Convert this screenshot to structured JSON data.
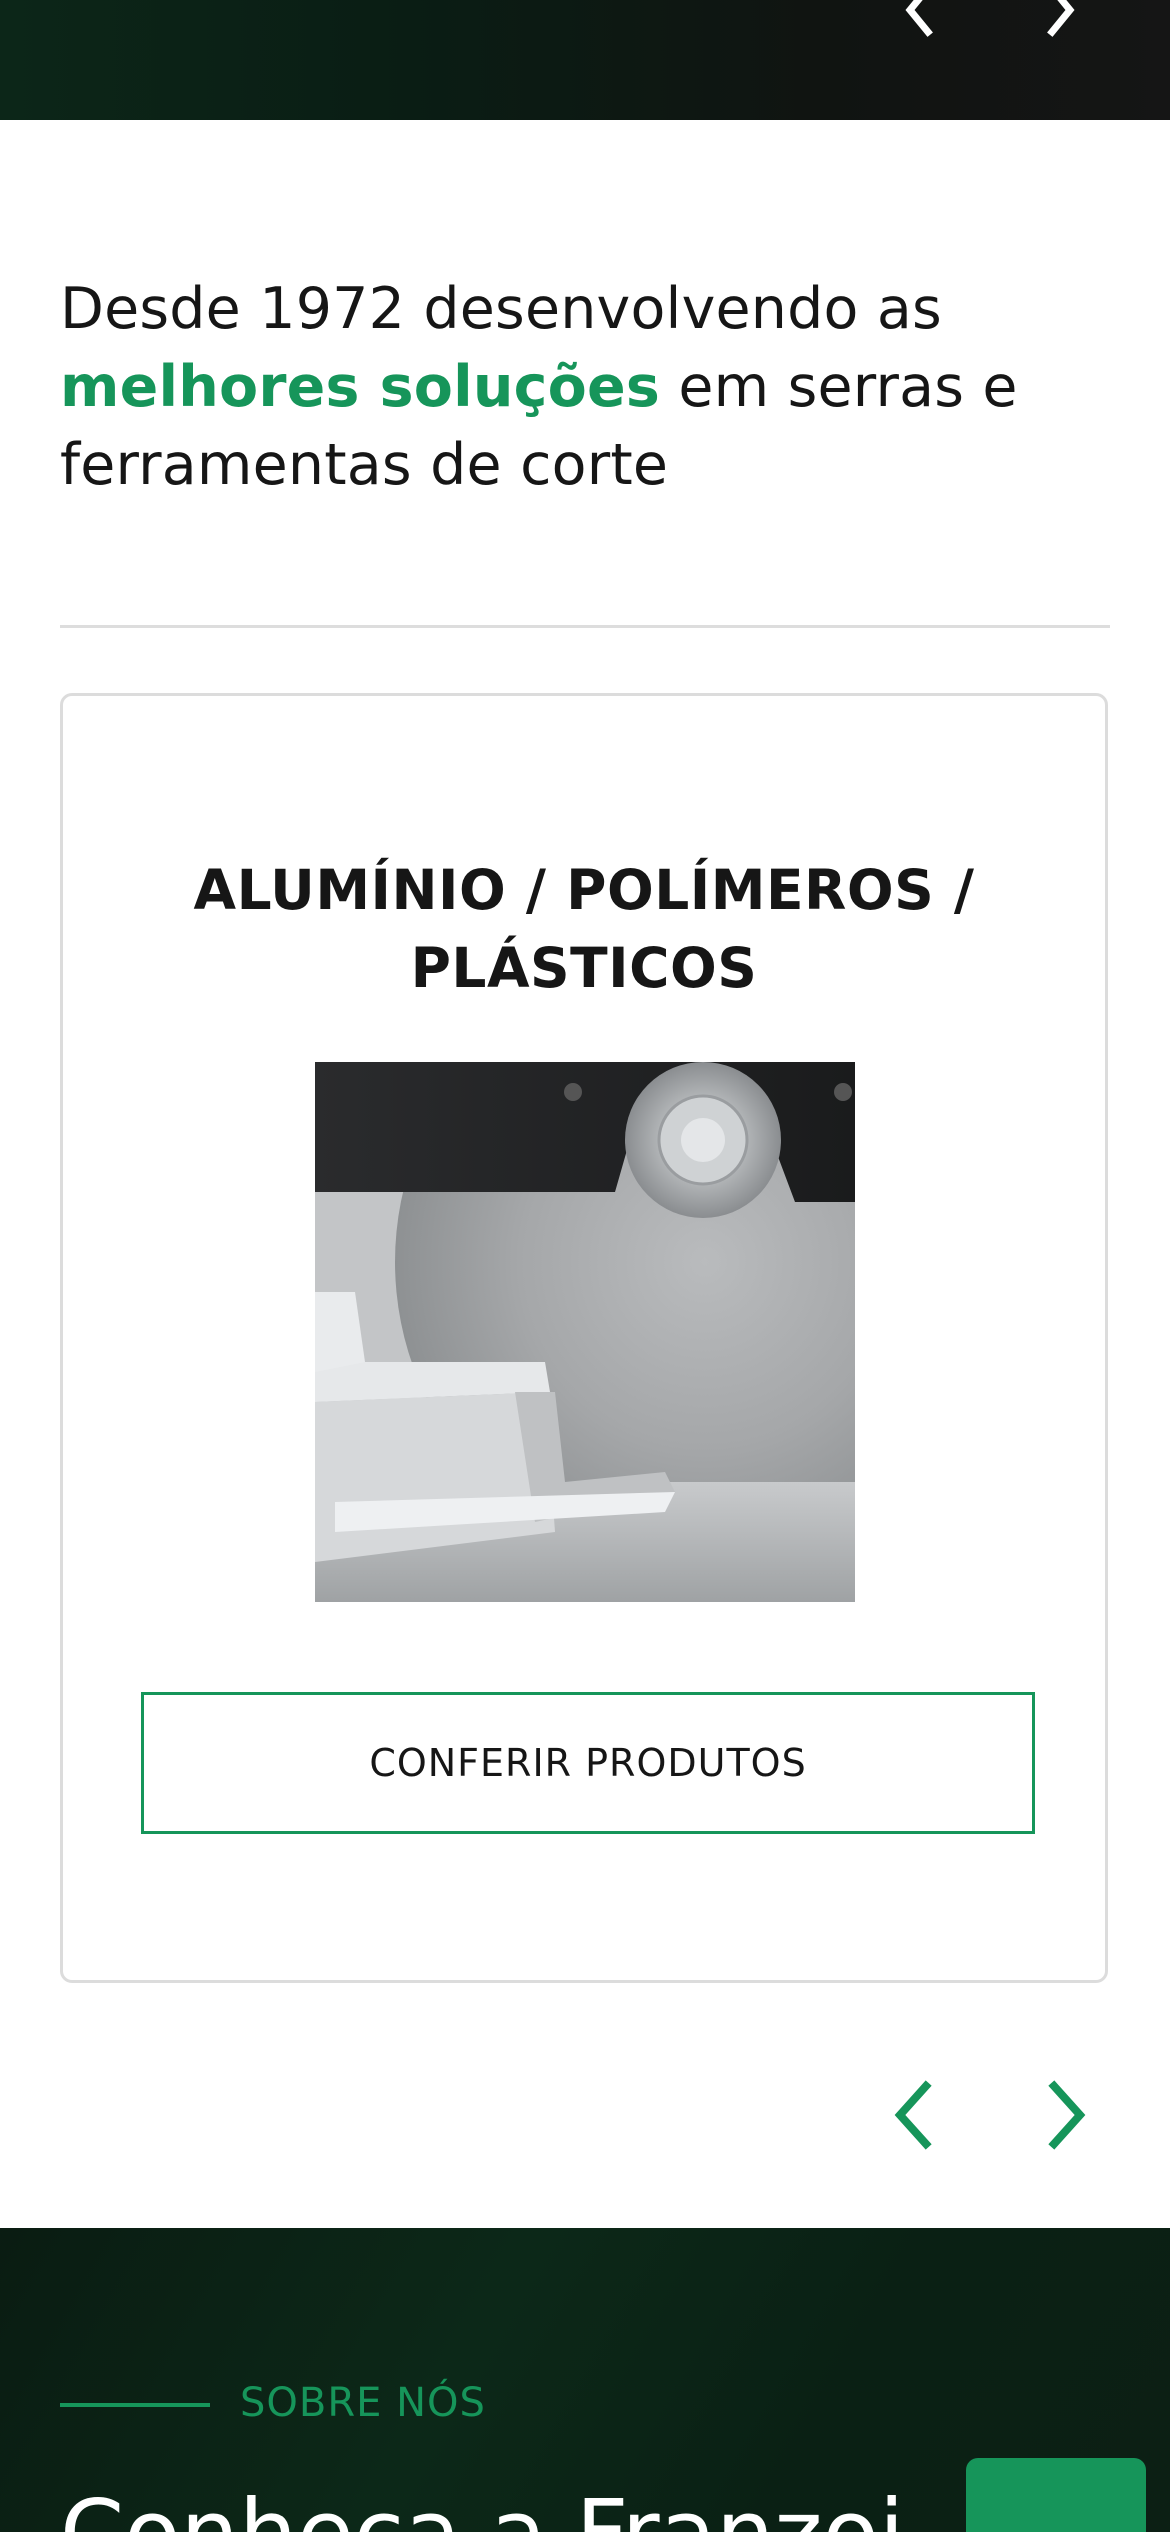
{
  "intro": {
    "line1": "Desde 1972 desenvolvendo as",
    "highlight": "melhores soluções",
    "line2_rest": " em serras e",
    "line3": "ferramentas de corte"
  },
  "card": {
    "title_line1": "ALUMÍNIO / POLÍMEROS /",
    "title_line2": "PLÁSTICOS",
    "button_label": "CONFERIR PRODUTOS"
  },
  "about": {
    "kicker": "SOBRE NÓS",
    "heading": "Conheça a Franzoi"
  },
  "icons": {
    "prev": "chevron-left-icon",
    "next": "chevron-right-icon"
  },
  "colors": {
    "accent": "#16955a",
    "dark_bg": "#0c2618",
    "text": "#161616"
  }
}
